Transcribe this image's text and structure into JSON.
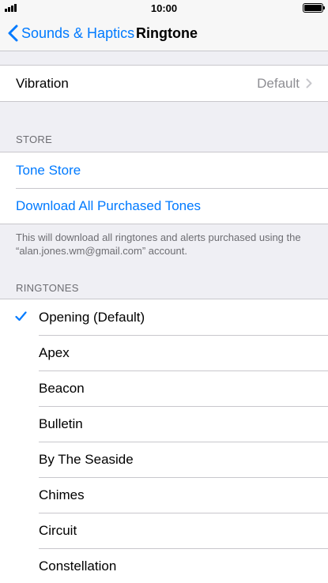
{
  "status": {
    "time": "10:00"
  },
  "nav": {
    "back_label": "Sounds & Haptics",
    "title": "Ringtone"
  },
  "vibration": {
    "label": "Vibration",
    "value": "Default"
  },
  "store": {
    "header": "STORE",
    "tone_store": "Tone Store",
    "download_all": "Download All Purchased Tones",
    "footer": "This will download all ringtones and alerts purchased using the “alan.jones.wm@gmail.com” account."
  },
  "ringtones": {
    "header": "RINGTONES",
    "selected_index": 0,
    "items": [
      {
        "label": "Opening (Default)"
      },
      {
        "label": "Apex"
      },
      {
        "label": "Beacon"
      },
      {
        "label": "Bulletin"
      },
      {
        "label": "By The Seaside"
      },
      {
        "label": "Chimes"
      },
      {
        "label": "Circuit"
      },
      {
        "label": "Constellation"
      }
    ]
  },
  "colors": {
    "accent": "#007aff",
    "background": "#efeff4",
    "secondary_text": "#8e8e93"
  }
}
